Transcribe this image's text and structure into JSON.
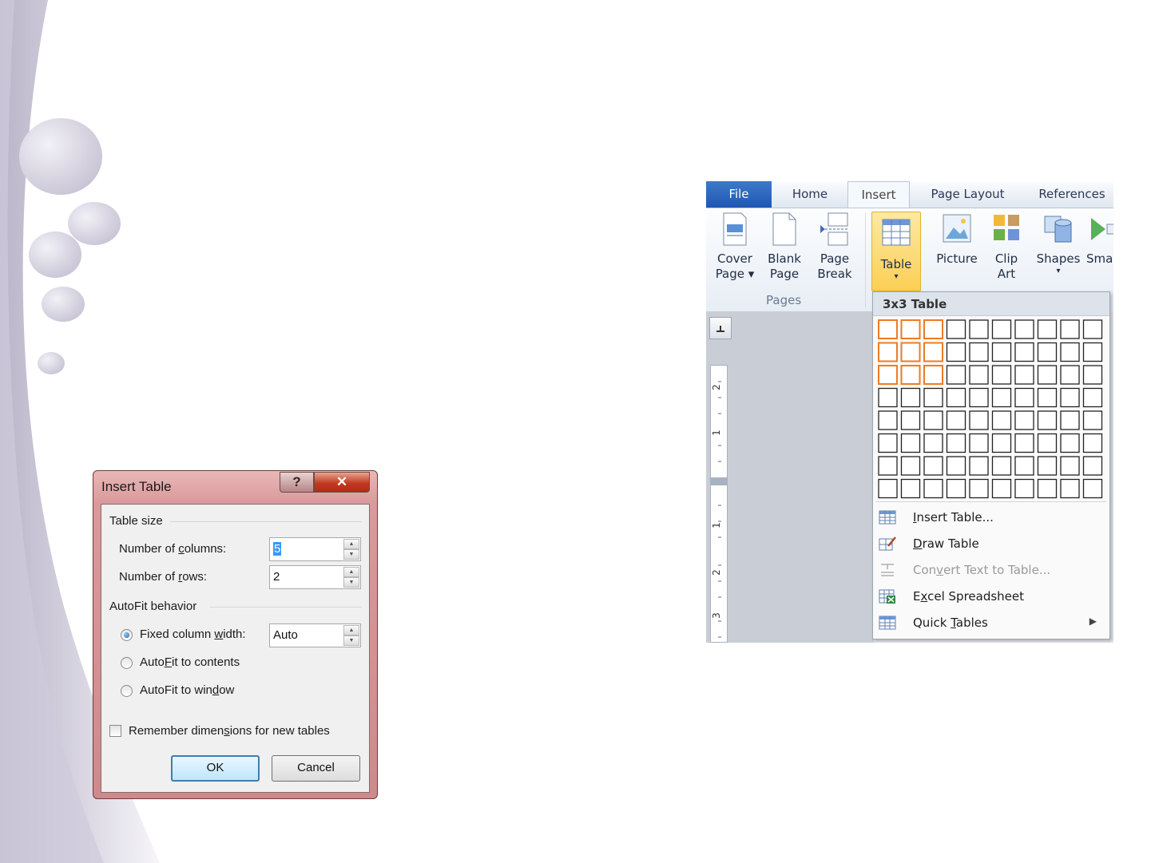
{
  "dialog": {
    "title": "Insert Table",
    "help_glyph": "?",
    "close_glyph": "✕",
    "table_size_group": "Table size",
    "columns_label": {
      "pre": "Number of ",
      "key": "c",
      "post": "olumns:"
    },
    "columns_value": "5",
    "rows_label": {
      "pre": "Number of ",
      "key": "r",
      "post": "ows:"
    },
    "rows_value": "2",
    "autofit_group": "AutoFit behavior",
    "fixed_label": {
      "pre": "Fixed column ",
      "key": "w",
      "post": "idth:"
    },
    "fixed_value": "Auto",
    "autofit_contents": {
      "pre": "Auto",
      "key": "F",
      "post": "it to contents"
    },
    "autofit_window": {
      "pre": "AutoFit to win",
      "key": "d",
      "post": "ow"
    },
    "remember": {
      "pre": "Remember dimen",
      "key": "s",
      "post": "ions for new tables"
    },
    "ok_label": "OK",
    "cancel_label": "Cancel",
    "selected_option": "fixed"
  },
  "ribbon": {
    "tabs": [
      "File",
      "Home",
      "Insert",
      "Page Layout",
      "References"
    ],
    "active_tab": "Insert",
    "buttons": {
      "cover_page": [
        "Cover",
        "Page ▾"
      ],
      "blank_page": [
        "Blank",
        "Page"
      ],
      "page_break": [
        "Page",
        "Break"
      ],
      "table": [
        "Table",
        "▾"
      ],
      "picture": [
        "Picture"
      ],
      "clip_art": [
        "Clip",
        "Art"
      ],
      "shapes": [
        "Shapes",
        "▾"
      ],
      "smartart": [
        "Sma"
      ]
    },
    "group_pages": "Pages"
  },
  "ruler": {
    "numbers": [
      "2",
      "1",
      "1",
      "2",
      "3"
    ]
  },
  "table_dropdown": {
    "header": "3x3 Table",
    "grid_cols": 10,
    "grid_rows": 8,
    "highlight_cols": 3,
    "highlight_rows": 3,
    "menu": [
      {
        "pre": "",
        "key": "I",
        "post": "nsert Table...",
        "disabled": false,
        "icon": "insert-table-icon"
      },
      {
        "pre": "",
        "key": "D",
        "post": "raw Table",
        "disabled": false,
        "icon": "draw-table-icon"
      },
      {
        "pre": "Con",
        "key": "v",
        "post": "ert Text to Table...",
        "disabled": true,
        "icon": "convert-text-icon"
      },
      {
        "pre": "E",
        "key": "x",
        "post": "cel Spreadsheet",
        "disabled": false,
        "icon": "excel-spreadsheet-icon"
      },
      {
        "pre": "Quick ",
        "key": "T",
        "post": "ables",
        "disabled": false,
        "icon": "quick-tables-icon",
        "submenu": "▶"
      }
    ]
  }
}
